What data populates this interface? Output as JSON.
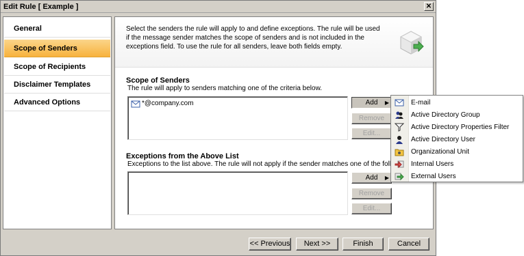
{
  "window": {
    "title": "Edit Rule [ Example ]",
    "close_glyph": "✕"
  },
  "nav": {
    "items": [
      {
        "label": "General",
        "active": false
      },
      {
        "label": "Scope of Senders",
        "active": true
      },
      {
        "label": "Scope of Recipients",
        "active": false
      },
      {
        "label": "Disclaimer Templates",
        "active": false
      },
      {
        "label": "Advanced Options",
        "active": false
      }
    ]
  },
  "header": {
    "description": "Select the senders the rule will apply to and define exceptions. The rule will be used if the message sender matches the scope of senders and is not included in the exceptions field. To use the rule for all senders, leave both fields empty.",
    "icon": "rule-icon"
  },
  "scope": {
    "title": "Scope of Senders",
    "subtitle": "The rule will apply to senders matching one of the criteria below.",
    "items": [
      "*@company.com"
    ],
    "add_label": "Add",
    "remove_label": "Remove",
    "edit_label": "Edit..."
  },
  "exceptions": {
    "title": "Exceptions from the Above List",
    "subtitle": "Exceptions to the list above. The rule will not apply if the sender matches one of the following criteria",
    "items": [],
    "add_label": "Add",
    "remove_label": "Remove",
    "edit_label": "Edit..."
  },
  "footer": {
    "previous_label": "<< Previous",
    "next_label": "Next >>",
    "finish_label": "Finish",
    "cancel_label": "Cancel"
  },
  "add_menu": {
    "items": [
      {
        "label": "E-mail",
        "icon": "email-icon"
      },
      {
        "label": "Active Directory Group",
        "icon": "ad-group-icon"
      },
      {
        "label": "Active Directory Properties Filter",
        "icon": "filter-icon"
      },
      {
        "label": "Active Directory User",
        "icon": "ad-user-icon"
      },
      {
        "label": "Organizational Unit",
        "icon": "org-unit-icon"
      },
      {
        "label": "Internal Users",
        "icon": "internal-users-icon"
      },
      {
        "label": "External Users",
        "icon": "external-users-icon"
      }
    ]
  }
}
